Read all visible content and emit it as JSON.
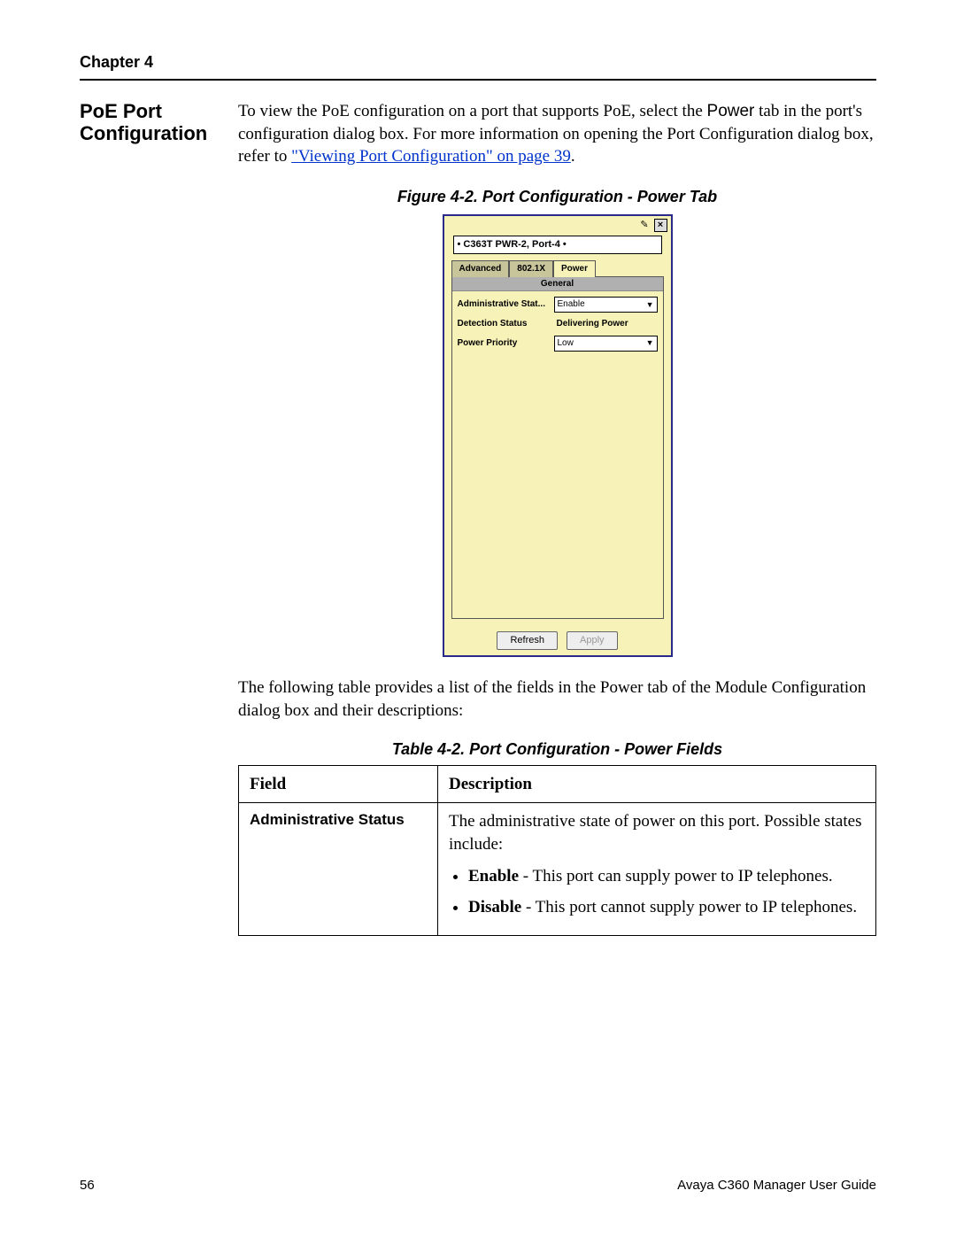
{
  "header": {
    "chapter": "Chapter 4"
  },
  "side_heading": "PoE Port Configuration",
  "intro": {
    "p1_a": "To view the PoE configuration on a port that supports PoE, select the ",
    "p1_power": "Power",
    "p1_b": " tab in the port's configuration dialog box. For more information on opening the Port Configuration dialog box, refer to ",
    "link_text": "\"Viewing Port Configuration\" on page 39",
    "p1_c": "."
  },
  "figure_caption": "Figure 4-2. Port Configuration - Power Tab",
  "dialog": {
    "title": "• C363T PWR-2, Port-4 •",
    "tabs": {
      "advanced": "Advanced",
      "dot1x": "802.1X",
      "power": "Power"
    },
    "section": "General",
    "fields": {
      "admin_label": "Administrative Stat...",
      "admin_value": "Enable",
      "detection_label": "Detection Status",
      "detection_value": "Delivering Power",
      "priority_label": "Power Priority",
      "priority_value": "Low"
    },
    "buttons": {
      "refresh": "Refresh",
      "apply": "Apply"
    }
  },
  "para2": "The following table provides a list of the fields in the Power tab of the Module Configuration dialog box and their descriptions:",
  "table_caption": "Table 4-2. Port Configuration - Power Fields",
  "table": {
    "h_field": "Field",
    "h_desc": "Description",
    "row1": {
      "field": "Administrative Status",
      "desc_intro": "The administrative state of power on this port. Possible states include:",
      "b1_strong": "Enable",
      "b1_rest": " - This port can supply power to IP telephones.",
      "b2_strong": "Disable",
      "b2_rest": " - This port cannot supply power to IP telephones."
    }
  },
  "footer": {
    "page": "56",
    "doc": "Avaya C360 Manager User Guide"
  }
}
